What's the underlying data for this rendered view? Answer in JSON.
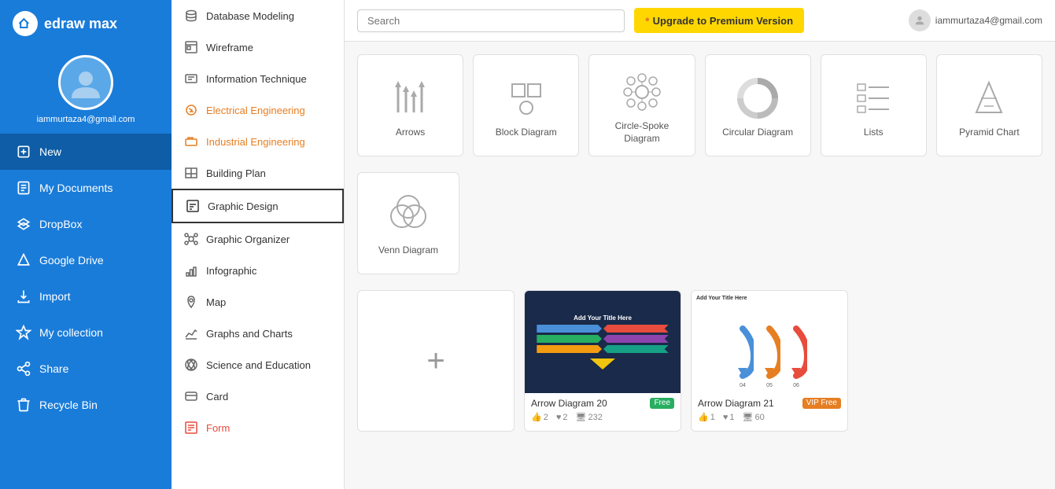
{
  "app": {
    "name": "edraw max",
    "logo_char": "d"
  },
  "user": {
    "email": "iammurtaza4@gmail.com",
    "email_short": "iammurtaza4@gmail.com"
  },
  "topbar": {
    "search_placeholder": "Search",
    "upgrade_label": "Upgrade to Premium Version"
  },
  "sidebar": {
    "items": [
      {
        "id": "new",
        "label": "New",
        "icon": "new-icon"
      },
      {
        "id": "my-documents",
        "label": "My Documents",
        "icon": "documents-icon"
      },
      {
        "id": "dropbox",
        "label": "DropBox",
        "icon": "dropbox-icon"
      },
      {
        "id": "google-drive",
        "label": "Google Drive",
        "icon": "drive-icon"
      },
      {
        "id": "import",
        "label": "Import",
        "icon": "import-icon"
      },
      {
        "id": "my-collection",
        "label": "My collection",
        "icon": "collection-icon"
      },
      {
        "id": "share",
        "label": "Share",
        "icon": "share-icon"
      },
      {
        "id": "recycle-bin",
        "label": "Recycle Bin",
        "icon": "recycle-icon"
      }
    ]
  },
  "middle_menu": {
    "items": [
      {
        "id": "database-modeling",
        "label": "Database Modeling",
        "color": "normal"
      },
      {
        "id": "wireframe",
        "label": "Wireframe",
        "color": "normal"
      },
      {
        "id": "information-technique",
        "label": "Information Technique",
        "color": "normal"
      },
      {
        "id": "electrical-engineering",
        "label": "Electrical Engineering",
        "color": "orange"
      },
      {
        "id": "industrial-engineering",
        "label": "Industrial Engineering",
        "color": "orange"
      },
      {
        "id": "building-plan",
        "label": "Building Plan",
        "color": "normal"
      },
      {
        "id": "graphic-design",
        "label": "Graphic Design",
        "color": "normal",
        "selected": true
      },
      {
        "id": "graphic-organizer",
        "label": "Graphic Organizer",
        "color": "normal"
      },
      {
        "id": "infographic",
        "label": "Infographic",
        "color": "normal"
      },
      {
        "id": "map",
        "label": "Map",
        "color": "normal"
      },
      {
        "id": "graphs-and-charts",
        "label": "Graphs and Charts",
        "color": "normal"
      },
      {
        "id": "science-and-education",
        "label": "Science and Education",
        "color": "normal"
      },
      {
        "id": "card",
        "label": "Card",
        "color": "normal"
      },
      {
        "id": "form",
        "label": "Form",
        "color": "red"
      }
    ]
  },
  "template_types": [
    {
      "id": "arrows",
      "label": "Arrows"
    },
    {
      "id": "block-diagram",
      "label": "Block Diagram"
    },
    {
      "id": "circle-spoke-diagram",
      "label": "Circle-Spoke Diagram"
    },
    {
      "id": "circular-diagram",
      "label": "Circular Diagram"
    },
    {
      "id": "lists",
      "label": "Lists"
    },
    {
      "id": "pyramid-chart",
      "label": "Pyramid Chart"
    },
    {
      "id": "venn-diagram",
      "label": "Venn Diagram"
    }
  ],
  "gallery": {
    "new_label": "+",
    "cards": [
      {
        "id": "arrow-diagram-20",
        "title": "Arrow Diagram 20",
        "badge": "Free",
        "badge_type": "free",
        "likes": "2",
        "hearts": "2",
        "views": "232"
      },
      {
        "id": "arrow-diagram-21",
        "title": "Arrow Diagram 21",
        "badge": "VIP Free",
        "badge_type": "vip",
        "likes": "1",
        "hearts": "1",
        "views": "60"
      }
    ]
  }
}
